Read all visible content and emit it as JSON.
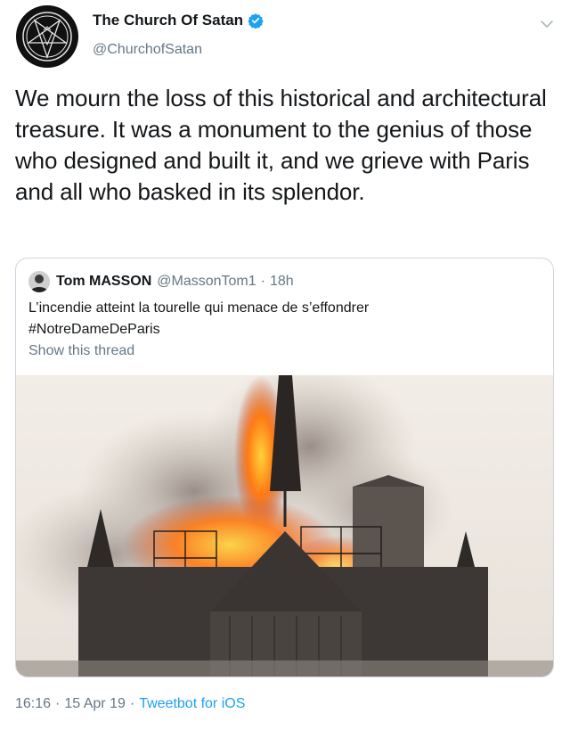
{
  "author": {
    "name": "The Church Of Satan",
    "handle": "@ChurchofSatan",
    "verified": true,
    "avatar_icon": "sigil-of-baphomet-icon"
  },
  "menu_icon": "chevron-down-icon",
  "tweet": {
    "text": "We mourn the loss of this historical and architectural treasure. It was a monument to the genius of those who designed and built it, and we grieve with Paris and all who basked in its splendor."
  },
  "quoted_tweet": {
    "name": "Tom MASSON",
    "handle": "@MassonTom1",
    "separator": "·",
    "time": "18h",
    "text_line1": "L’incendie atteint la tourelle qui menace de s’effondrer",
    "text_line2": "#NotreDameDeParis",
    "show_thread": "Show this thread",
    "image_subject": "notre-dame-fire-photo"
  },
  "footer": {
    "time": "16:16",
    "separator": "·",
    "date": "15 Apr 19",
    "source": "Tweetbot for iOS"
  },
  "colors": {
    "text": "#14171a",
    "secondary": "#657786",
    "link": "#1da1f2",
    "border": "#ccd6dd"
  }
}
